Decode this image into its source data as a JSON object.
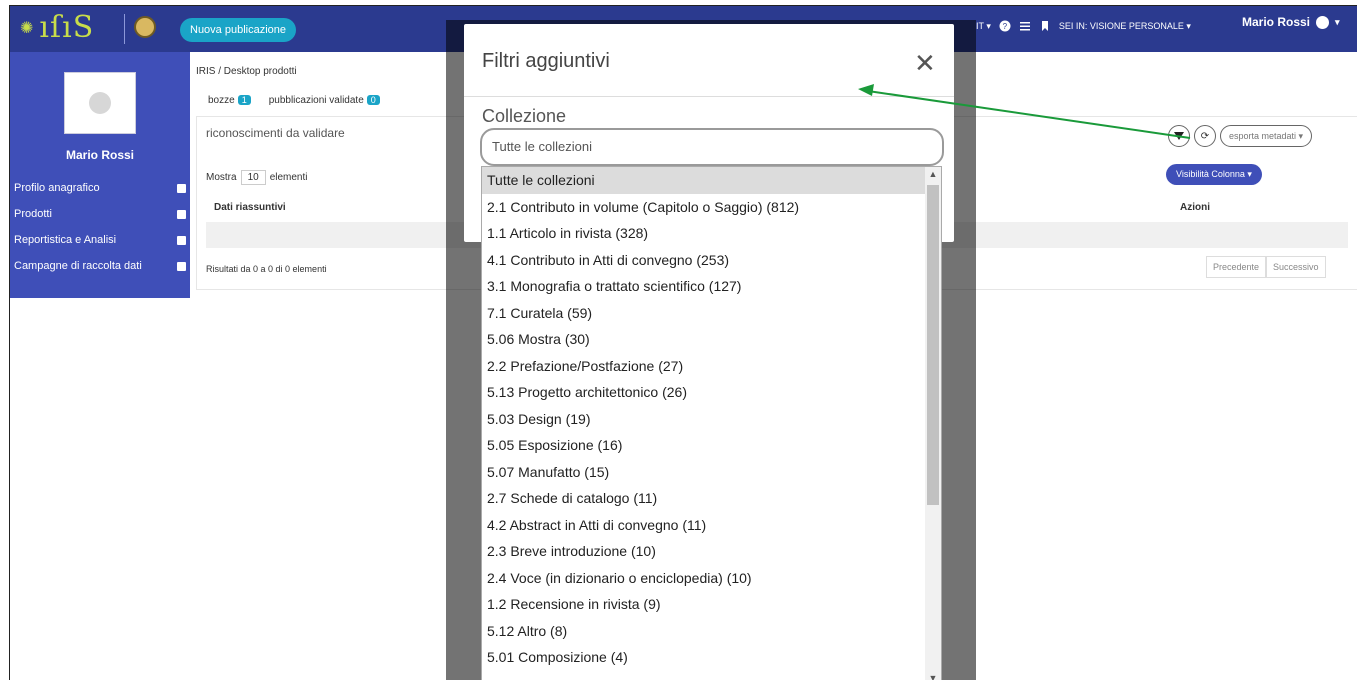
{
  "navbar": {
    "new_publication": "Nuova publicazione",
    "lang": "IT ▾",
    "context": "SEI IN: VISIONE PERSONALE ▾",
    "user": "Mario Rossi"
  },
  "sidebar": {
    "name": "Mario Rossi",
    "items": [
      {
        "label": "Profilo anagrafico"
      },
      {
        "label": "Prodotti"
      },
      {
        "label": "Reportistica e Analisi"
      },
      {
        "label": "Campagne di raccolta dati"
      }
    ]
  },
  "main": {
    "breadcrumb": "IRIS / Desktop prodotti",
    "tabs": [
      {
        "label": "bozze",
        "count": "1"
      },
      {
        "label": "pubblicazioni validate",
        "count": "0"
      }
    ],
    "card_title": "riconoscimenti da validare",
    "show_label": "Mostra",
    "show_value": "10",
    "show_suffix": "elementi",
    "col_summary": "Dati riassuntivi",
    "col_actions": "Azioni",
    "results": "Risultati da 0 a 0 di 0 elementi",
    "prev": "Precedente",
    "next": "Successivo",
    "export": "esporta metadati ▾",
    "visibility": "Visibilità Colonna ▾"
  },
  "modal": {
    "title": "Filtri aggiuntivi",
    "close": "✕",
    "collection_label": "Collezione",
    "select_value": "Tutte le collezioni"
  },
  "dropdown": {
    "options": [
      "Tutte le collezioni",
      "2.1 Contributo in volume (Capitolo o Saggio) (812)",
      "1.1 Articolo in rivista (328)",
      "4.1 Contributo in Atti di convegno (253)",
      "3.1 Monografia o trattato scientifico (127)",
      "7.1 Curatela (59)",
      "5.06 Mostra (30)",
      "2.2 Prefazione/Postfazione (27)",
      "5.13 Progetto architettonico (26)",
      "5.03 Design (19)",
      "5.05 Esposizione (16)",
      "5.07 Manufatto (15)",
      "2.7 Schede di catalogo (11)",
      "4.2 Abstract in Atti di convegno (11)",
      "2.3 Breve introduzione (10)",
      "2.4 Voce (in dizionario o enciclopedia) (10)",
      "1.2 Recensione in rivista (9)",
      "5.12 Altro (8)",
      "5.01 Composizione (4)"
    ]
  },
  "colors": {
    "navbar": "#2b3a8f",
    "sidebar": "#3f4fb8",
    "accent": "#1aa4c7",
    "arrow": "#1a9a3a"
  }
}
